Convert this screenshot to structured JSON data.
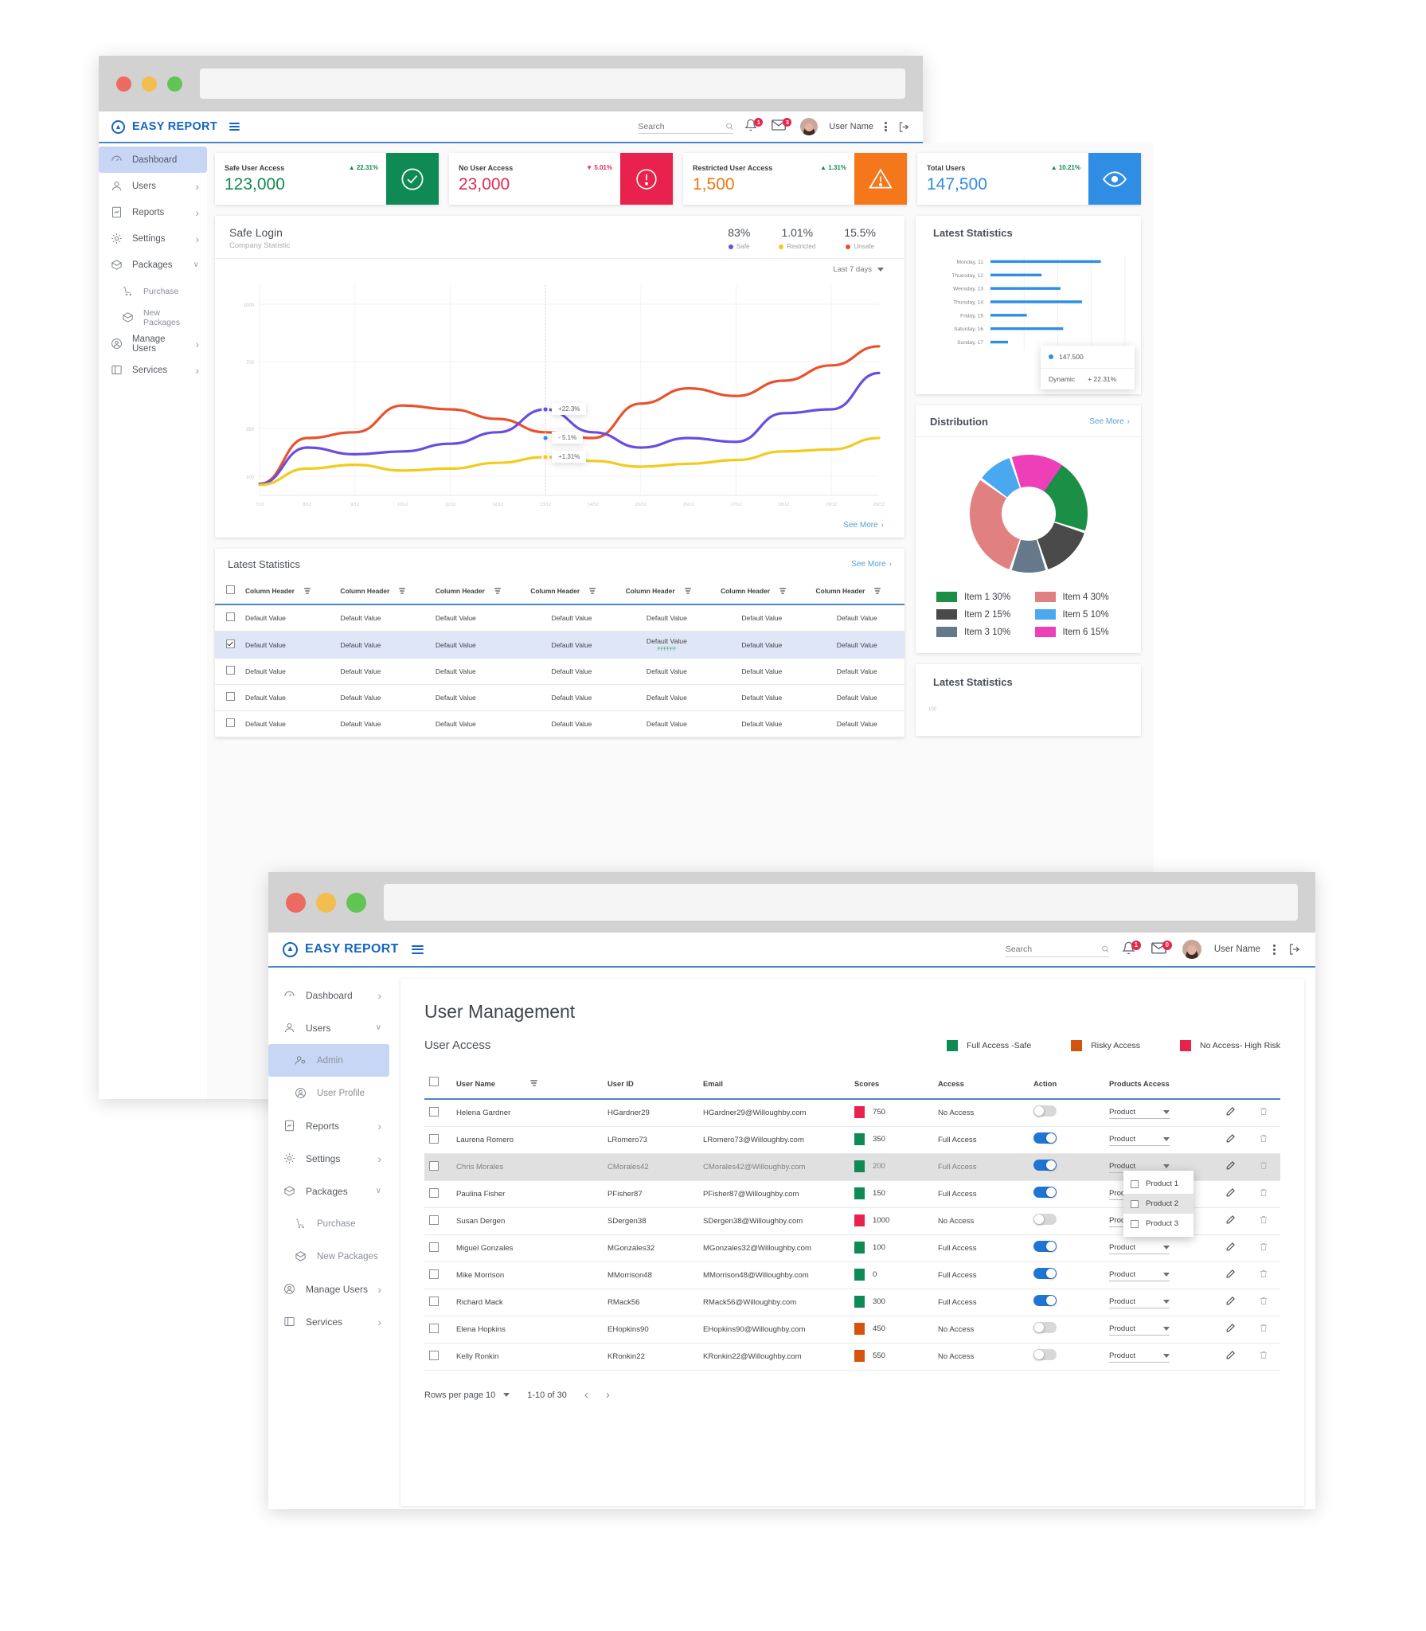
{
  "app": {
    "brand": "EASY REPORT",
    "menu_icon": "hamburger-icon",
    "search_placeholder": "Search",
    "search_value": "",
    "notifications_count": "1",
    "messages_count": "3",
    "user_name": "User Name",
    "logout_icon": "logout-icon",
    "kebab_icon": "more-vertical-icon"
  },
  "window2": {
    "notifications_count": "1",
    "messages_count": "0"
  },
  "sidebar1": {
    "items": [
      {
        "label": "Dashboard",
        "icon": "dashboard-icon",
        "chevron": "",
        "active": true,
        "sub": false
      },
      {
        "label": "Users",
        "icon": "user-icon",
        "chevron": "›",
        "active": false,
        "sub": false
      },
      {
        "label": "Reports",
        "icon": "report-icon",
        "chevron": "›",
        "active": false,
        "sub": false
      },
      {
        "label": "Settings",
        "icon": "gear-icon",
        "chevron": "›",
        "active": false,
        "sub": false
      },
      {
        "label": "Packages",
        "icon": "package-icon",
        "chevron": "∨",
        "active": false,
        "sub": false
      },
      {
        "label": "Purchase",
        "icon": "cart-icon",
        "chevron": "",
        "active": false,
        "sub": true
      },
      {
        "label": "New Packages",
        "icon": "package-icon",
        "chevron": "",
        "active": false,
        "sub": true
      },
      {
        "label": "Manage Users",
        "icon": "manage-users-icon",
        "chevron": "›",
        "active": false,
        "sub": false
      },
      {
        "label": "Services",
        "icon": "services-icon",
        "chevron": "›",
        "active": false,
        "sub": false
      }
    ]
  },
  "sidebar2": {
    "items": [
      {
        "label": "Dashboard",
        "icon": "dashboard-icon",
        "chevron": "›",
        "active": false,
        "sub": false
      },
      {
        "label": "Users",
        "icon": "user-icon",
        "chevron": "∨",
        "active": false,
        "sub": false
      },
      {
        "label": "Admin",
        "icon": "admin-icon",
        "chevron": "",
        "active": true,
        "sub": true
      },
      {
        "label": "User Profile",
        "icon": "user-circle-icon",
        "chevron": "",
        "active": false,
        "sub": true
      },
      {
        "label": "Reports",
        "icon": "report-icon",
        "chevron": "›",
        "active": false,
        "sub": false
      },
      {
        "label": "Settings",
        "icon": "gear-icon",
        "chevron": "›",
        "active": false,
        "sub": false
      },
      {
        "label": "Packages",
        "icon": "package-icon",
        "chevron": "∨",
        "active": false,
        "sub": false
      },
      {
        "label": "Purchase",
        "icon": "cart-icon",
        "chevron": "",
        "active": false,
        "sub": true
      },
      {
        "label": "New Packages",
        "icon": "package-icon",
        "chevron": "",
        "active": false,
        "sub": true
      },
      {
        "label": "Manage Users",
        "icon": "manage-users-icon",
        "chevron": "›",
        "active": false,
        "sub": false
      },
      {
        "label": "Services",
        "icon": "services-icon",
        "chevron": "›",
        "active": false,
        "sub": false
      }
    ]
  },
  "stats": [
    {
      "label": "Safe User Access",
      "delta": "22.31%",
      "dir": "up",
      "value": "123,000",
      "value_color": "#128a53",
      "delta_color": "#128a53",
      "tile_color": "#0f8a55",
      "icon": "check-circle-icon"
    },
    {
      "label": "No User Access",
      "delta": "5.01%",
      "dir": "down",
      "value": "23,000",
      "value_color": "#e12a4f",
      "delta_color": "#e12a4f",
      "tile_color": "#e8224c",
      "icon": "alert-circle-icon"
    },
    {
      "label": "Restricted User Access",
      "delta": "1.31%",
      "dir": "up",
      "value": "1,500",
      "value_color": "#f07513",
      "delta_color": "#128a53",
      "tile_color": "#f4781b",
      "icon": "warning-triangle-icon"
    },
    {
      "label": "Total Users",
      "delta": "10.21%",
      "dir": "up",
      "value": "147,500",
      "value_color": "#2f8de0",
      "delta_color": "#128a53",
      "tile_color": "#2f8de4",
      "icon": "eye-icon"
    }
  ],
  "safe_login": {
    "title": "Safe Login",
    "subtitle": "Company Statistic",
    "range_label": "Last 7 days",
    "see_more": "See More",
    "kpis": [
      {
        "value": "83%",
        "label": "Safe",
        "color": "#6a4de0"
      },
      {
        "value": "1.01%",
        "label": "Restricted",
        "color": "#f2cb1d"
      },
      {
        "value": "15.5%",
        "label": "Unsafe",
        "color": "#e8522d"
      }
    ],
    "tooltips": [
      {
        "text": "+22.3%",
        "color": "#6a4de0"
      },
      {
        "text": "- 5.1%",
        "color": "#2f8de4"
      },
      {
        "text": "+1.31%",
        "color": "#f2cb1d"
      }
    ]
  },
  "chart_data": [
    {
      "type": "line",
      "title": "Safe Login",
      "subtitle": "Company Statistic",
      "xlabel": "",
      "ylabel": "",
      "ylim": [
        0,
        1100
      ],
      "yticks": [
        100,
        350,
        700,
        1000
      ],
      "grid": true,
      "legend_position": "top-right",
      "x": [
        "7/12",
        "8/12",
        "9/12",
        "10/12",
        "11/12",
        "12/12",
        "13/12",
        "14/12",
        "15/12",
        "16/12",
        "17/12",
        "18/12",
        "19/12",
        "20/12"
      ],
      "series": [
        {
          "name": "Unsafe",
          "color": "#e8522d",
          "pct": "15.5%",
          "values": [
            60,
            300,
            330,
            470,
            450,
            400,
            330,
            300,
            480,
            560,
            520,
            600,
            680,
            780
          ]
        },
        {
          "name": "Safe",
          "color": "#6a4de0",
          "pct": "83%",
          "values": [
            60,
            250,
            215,
            230,
            270,
            330,
            450,
            330,
            250,
            300,
            280,
            430,
            450,
            640
          ]
        },
        {
          "name": "Restricted",
          "color": "#f2cb1d",
          "pct": "1.01%",
          "values": [
            55,
            140,
            160,
            130,
            140,
            170,
            200,
            180,
            150,
            165,
            185,
            230,
            240,
            300
          ]
        }
      ],
      "annotations": [
        "+22.3%",
        "- 5.1%",
        "+1.31%"
      ]
    },
    {
      "type": "bar",
      "title": "Latest Statistics",
      "orientation": "horizontal",
      "categories": [
        "Monday, 11",
        "Thuesday, 12",
        "Wensday, 13",
        "Thursday, 14",
        "Friday, 15",
        "Saturday, 16",
        "Sunday, 17"
      ],
      "values": [
        82,
        38,
        52,
        68,
        27,
        54,
        13
      ],
      "color": "#2f8de4",
      "grid": true,
      "tooltip": {
        "value": "147.500",
        "label": "Dynamic",
        "delta": "+ 22.31%"
      }
    },
    {
      "type": "pie",
      "title": "Distribution",
      "labels": [
        "Item 1 30%",
        "Item 2 15%",
        "Item 3 10%",
        "Item 4 30%",
        "Item 5 10%",
        "Item 6 15%"
      ],
      "names": [
        "Item 1",
        "Item 2",
        "Item 3",
        "Item 4",
        "Item 5",
        "Item 6"
      ],
      "values": [
        30,
        15,
        10,
        30,
        10,
        15
      ],
      "colors": [
        "#1a8f45",
        "#4a4a4a",
        "#66798a",
        "#e08080",
        "#4aa8f0",
        "#ee3fb8"
      ],
      "legend_position": "bottom"
    }
  ],
  "latest_stats_bar": {
    "title": "Latest Statistics",
    "tooltip_value": "147.500",
    "tooltip_label": "Dynamic",
    "tooltip_delta": "+ 22.31%"
  },
  "distribution": {
    "title": "Distribution",
    "see_more": "See More"
  },
  "latest_stats_bottom": {
    "title": "Latest Statistics"
  },
  "latest_stats_table": {
    "title": "Latest Statistics",
    "see_more": "See More",
    "headers": [
      "Column Header",
      "Column Header",
      "Column Header",
      "Column Header",
      "Column Header",
      "Column Header",
      "Column Header"
    ],
    "rows": [
      {
        "checked": false,
        "cells": [
          "Default Value",
          "Default Value",
          "Default Value",
          "Default Value",
          "Default Value",
          "Default Value",
          "Default Value"
        ]
      },
      {
        "checked": true,
        "cells": [
          "Default Value",
          "Default Value",
          "Default Value",
          "Default Value",
          "Default Value",
          "Default Value",
          "Default Value"
        ]
      },
      {
        "checked": false,
        "cells": [
          "Default Value",
          "Default Value",
          "Default Value",
          "Default Value",
          "Default Value",
          "Default Value",
          "Default Value"
        ]
      },
      {
        "checked": false,
        "cells": [
          "Default Value",
          "Default Value",
          "Default Value",
          "Default Value",
          "Default Value",
          "Default Value",
          "Default Value"
        ]
      },
      {
        "checked": false,
        "cells": [
          "Default Value",
          "Default Value",
          "Default Value",
          "Default Value",
          "Default Value",
          "Default Value",
          "Default Value"
        ]
      }
    ],
    "hex_note": "FFFFFF"
  },
  "user_management": {
    "title": "User Management",
    "subtitle": "User Access",
    "legend": [
      {
        "label": "Full Access -Safe",
        "color": "#0f8a55"
      },
      {
        "label": "Risky Access",
        "color": "#d4540d"
      },
      {
        "label": "No Access- High Risk",
        "color": "#e8224c"
      }
    ],
    "headers": [
      "User Name",
      "User ID",
      "Email",
      "Scores",
      "Access",
      "Action",
      "Products Access"
    ],
    "product_label": "Product",
    "rows": [
      {
        "name": "Helena Gardner",
        "id": "HGardner29",
        "email": "HGardner29@Willoughby.com",
        "score": "750",
        "score_color": "#e8224c",
        "access": "No Access",
        "toggle": false,
        "selected": false
      },
      {
        "name": "Laurena Romero",
        "id": "LRomero73",
        "email": "LRomero73@Willoughby.com",
        "score": "350",
        "score_color": "#0f8a55",
        "access": "Full Access",
        "toggle": true,
        "selected": false
      },
      {
        "name": "Chris Morales",
        "id": "CMorales42",
        "email": "CMorales42@Willoughby.com",
        "score": "200",
        "score_color": "#0f8a55",
        "access": "Full Access",
        "toggle": true,
        "selected": true
      },
      {
        "name": "Paulina Fisher",
        "id": "PFisher87",
        "email": "PFisher87@Willoughby.com",
        "score": "150",
        "score_color": "#0f8a55",
        "access": "Full Access",
        "toggle": true,
        "selected": false
      },
      {
        "name": "Susan Dergen",
        "id": "SDergen38",
        "email": "SDergen38@Willoughby.com",
        "score": "1000",
        "score_color": "#e8224c",
        "access": "No Access",
        "toggle": false,
        "selected": false
      },
      {
        "name": "Miguel Gonzales",
        "id": "MGonzales32",
        "email": "MGonzales32@Willoughby.com",
        "score": "100",
        "score_color": "#0f8a55",
        "access": "Full Access",
        "toggle": true,
        "selected": false
      },
      {
        "name": "Mike Morrison",
        "id": "MMorrison48",
        "email": "MMorrison48@Willoughby.com",
        "score": "0",
        "score_color": "#0f8a55",
        "access": "Full Access",
        "toggle": true,
        "selected": false
      },
      {
        "name": "Richard Mack",
        "id": "RMack56",
        "email": "RMack56@Willoughby.com",
        "score": "300",
        "score_color": "#0f8a55",
        "access": "Full Access",
        "toggle": true,
        "selected": false
      },
      {
        "name": "Elena Hopkins",
        "id": "EHopkins90",
        "email": "EHopkins90@Willoughby.com",
        "score": "450",
        "score_color": "#d4540d",
        "access": "No Access",
        "toggle": false,
        "selected": false
      },
      {
        "name": "Kelly Ronkin",
        "id": "KRonkin22",
        "email": "KRonkin22@Willoughby.com",
        "score": "550",
        "score_color": "#d4540d",
        "access": "No Access",
        "toggle": false,
        "selected": false
      }
    ],
    "dropdown": {
      "options": [
        "Product 1",
        "Product 2",
        "Product 3"
      ],
      "hover_index": 1
    },
    "footer": {
      "rows_per_page_label": "Rows per page 10",
      "range_label": "1-10 of 30",
      "prev": "‹",
      "next": "›"
    }
  }
}
